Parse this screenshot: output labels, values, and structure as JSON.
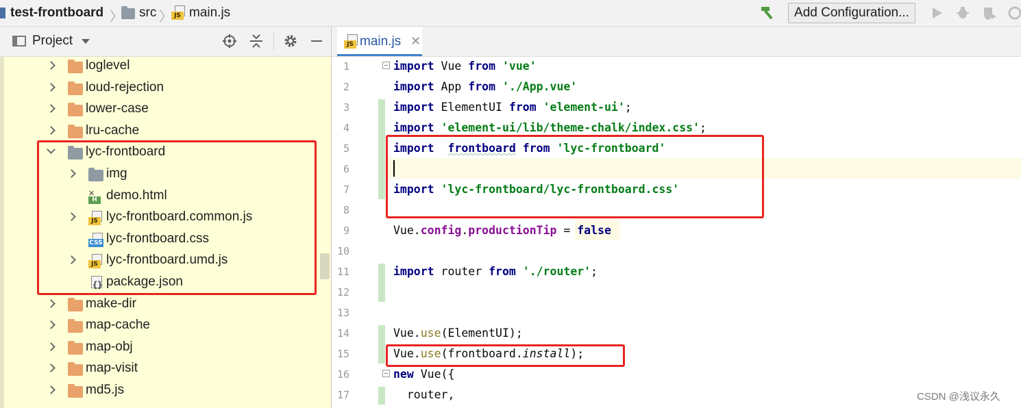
{
  "navbar": {
    "project": "test-frontboard",
    "folder": "src",
    "file": "main.js",
    "add_configuration_label": "Add Configuration..."
  },
  "project_panel": {
    "title": "Project",
    "tree": [
      {
        "label": "loglevel",
        "kind": "folder",
        "expand": "collapsed",
        "depth": 0
      },
      {
        "label": "loud-rejection",
        "kind": "folder",
        "expand": "collapsed",
        "depth": 0
      },
      {
        "label": "lower-case",
        "kind": "folder",
        "expand": "collapsed",
        "depth": 0
      },
      {
        "label": "lru-cache",
        "kind": "folder",
        "expand": "collapsed",
        "depth": 0
      },
      {
        "label": "lyc-frontboard",
        "kind": "folder-grey",
        "expand": "expanded",
        "depth": 0
      },
      {
        "label": "img",
        "kind": "folder-grey",
        "expand": "collapsed",
        "depth": 1
      },
      {
        "label": "demo.html",
        "kind": "html",
        "expand": "none",
        "depth": 1
      },
      {
        "label": "lyc-frontboard.common.js",
        "kind": "js",
        "expand": "collapsed",
        "depth": 1
      },
      {
        "label": "lyc-frontboard.css",
        "kind": "css",
        "expand": "none",
        "depth": 1
      },
      {
        "label": "lyc-frontboard.umd.js",
        "kind": "js",
        "expand": "collapsed",
        "depth": 1
      },
      {
        "label": "package.json",
        "kind": "json",
        "expand": "none",
        "depth": 1
      },
      {
        "label": "make-dir",
        "kind": "folder",
        "expand": "collapsed",
        "depth": 0
      },
      {
        "label": "map-cache",
        "kind": "folder",
        "expand": "collapsed",
        "depth": 0
      },
      {
        "label": "map-obj",
        "kind": "folder",
        "expand": "collapsed",
        "depth": 0
      },
      {
        "label": "map-visit",
        "kind": "folder",
        "expand": "collapsed",
        "depth": 0
      },
      {
        "label": "md5.js",
        "kind": "folder",
        "expand": "collapsed",
        "depth": 0
      }
    ]
  },
  "editor": {
    "tab_label": "main.js",
    "line_numbers": [
      "1",
      "2",
      "3",
      "4",
      "5",
      "6",
      "7",
      "8",
      "9",
      "10",
      "11",
      "12",
      "13",
      "14",
      "15",
      "16",
      "17"
    ],
    "lines": [
      [
        {
          "t": "import",
          "c": "kw"
        },
        {
          "t": " Vue "
        },
        {
          "t": "from",
          "c": "kw"
        },
        {
          "t": " "
        },
        {
          "t": "'vue'",
          "c": "str"
        }
      ],
      [
        {
          "t": "import",
          "c": "kw"
        },
        {
          "t": " App "
        },
        {
          "t": "from",
          "c": "kw"
        },
        {
          "t": " "
        },
        {
          "t": "'./App.vue'",
          "c": "str"
        }
      ],
      [
        {
          "t": "import",
          "c": "kw"
        },
        {
          "t": " ElementUI "
        },
        {
          "t": "from",
          "c": "kw"
        },
        {
          "t": " "
        },
        {
          "t": "'element-ui'",
          "c": "str"
        },
        {
          "t": ";"
        }
      ],
      [
        {
          "t": "import",
          "c": "kw"
        },
        {
          "t": " "
        },
        {
          "t": "'element-ui/lib/theme-chalk/index.css'",
          "c": "str"
        },
        {
          "t": ";"
        }
      ],
      [
        {
          "t": "import",
          "c": "kw"
        },
        {
          "t": "  "
        },
        {
          "t": "frontboard",
          "c": "kw wavy"
        },
        {
          "t": " "
        },
        {
          "t": "from",
          "c": "kw"
        },
        {
          "t": " "
        },
        {
          "t": "'lyc-frontboard'",
          "c": "str"
        }
      ],
      [],
      [
        {
          "t": "import",
          "c": "kw"
        },
        {
          "t": " "
        },
        {
          "t": "'lyc-frontboard/lyc-frontboard.css'",
          "c": "str"
        }
      ],
      [],
      [
        {
          "t": "Vue."
        },
        {
          "t": "config",
          "c": "prop"
        },
        {
          "t": "."
        },
        {
          "t": "productionTip",
          "c": "prop"
        },
        {
          "t": " = "
        },
        {
          "t": "false",
          "c": "kw"
        }
      ],
      [],
      [
        {
          "t": "import",
          "c": "kw"
        },
        {
          "t": " router "
        },
        {
          "t": "from",
          "c": "kw"
        },
        {
          "t": " "
        },
        {
          "t": "'./router'",
          "c": "str"
        },
        {
          "t": ";"
        }
      ],
      [],
      [],
      [
        {
          "t": "Vue."
        },
        {
          "t": "use",
          "c": "fn"
        },
        {
          "t": "(ElementUI);"
        }
      ],
      [
        {
          "t": "Vue."
        },
        {
          "t": "use",
          "c": "fn"
        },
        {
          "t": "(frontboard."
        },
        {
          "t": "install",
          "c": "italic"
        },
        {
          "t": ");"
        }
      ],
      [
        {
          "t": "new",
          "c": "kw"
        },
        {
          "t": " Vue({"
        }
      ],
      [
        {
          "t": "  router,"
        }
      ]
    ]
  },
  "watermark": "CSDN @浅议永久",
  "colors": {
    "annotation": "#e8231f",
    "tree_bg": "#fefed7",
    "accent_tab": "#4083c9"
  }
}
